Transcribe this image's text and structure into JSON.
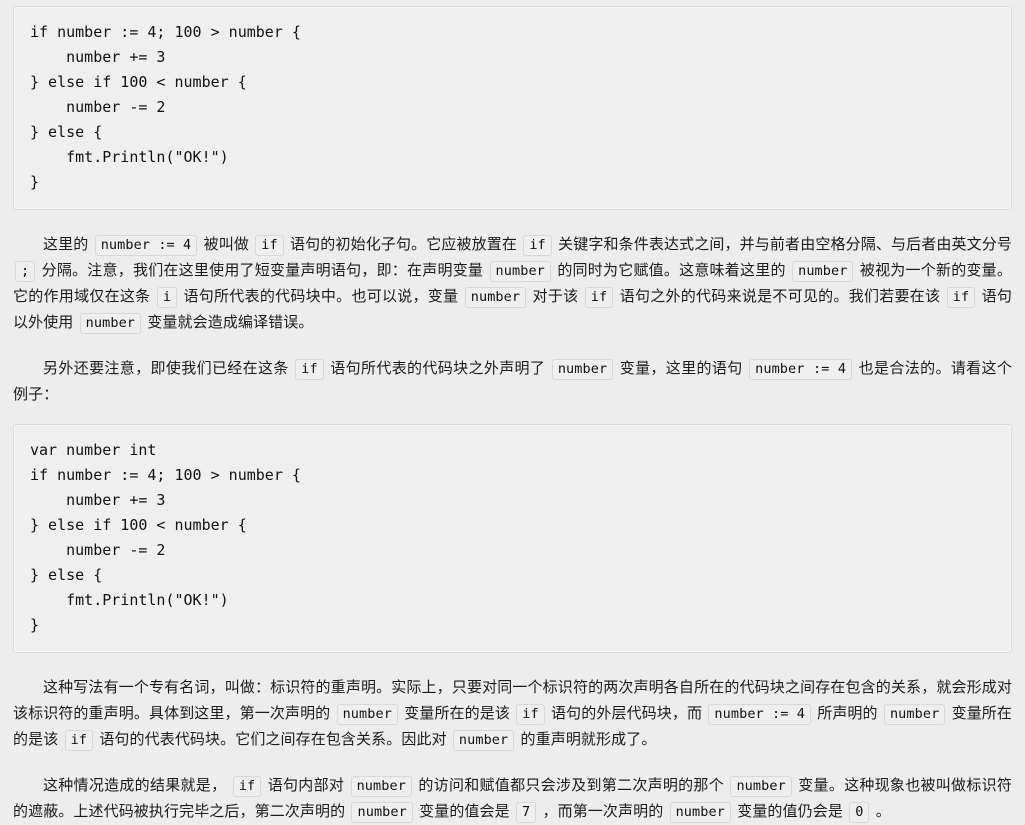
{
  "code_blocks": [
    {
      "id": "code-block-1",
      "language": "go",
      "lines": [
        "if number := 4; 100 > number {",
        "    number += 3",
        "} else if 100 < number {",
        "    number -= 2",
        "} else {",
        "    fmt.Println(\"OK!\")",
        "}"
      ],
      "text": "if number := 4; 100 > number {\n    number += 3\n} else if 100 < number {\n    number -= 2\n} else {\n    fmt.Println(\"OK!\")\n}"
    },
    {
      "id": "code-block-2",
      "language": "go",
      "lines": [
        "var number int",
        "if number := 4; 100 > number {",
        "    number += 3",
        "} else if 100 < number {",
        "    number -= 2",
        "} else {",
        "    fmt.Println(\"OK!\")",
        "}"
      ],
      "text": "var number int\nif number := 4; 100 > number {\n    number += 3\n} else if 100 < number {\n    number -= 2\n} else {\n    fmt.Println(\"OK!\")\n}"
    }
  ],
  "paragraphs": [
    {
      "id": "paragraph-1",
      "segments": [
        {
          "type": "text",
          "value": "这里的 "
        },
        {
          "type": "code",
          "value": "number := 4"
        },
        {
          "type": "text",
          "value": " 被叫做 "
        },
        {
          "type": "code",
          "value": "if"
        },
        {
          "type": "text",
          "value": " 语句的初始化子句。它应被放置在 "
        },
        {
          "type": "code",
          "value": "if"
        },
        {
          "type": "text",
          "value": " 关键字和条件表达式之间，并与前者由空格分隔、与后者由英文分号 "
        },
        {
          "type": "code",
          "value": ";"
        },
        {
          "type": "text",
          "value": " 分隔。注意，我们在这里使用了短变量声明语句，即：在声明变量 "
        },
        {
          "type": "code",
          "value": "number"
        },
        {
          "type": "text",
          "value": " 的同时为它赋值。这意味着这里的 "
        },
        {
          "type": "code",
          "value": "number"
        },
        {
          "type": "text",
          "value": " 被视为一个新的变量。它的作用域仅在这条 "
        },
        {
          "type": "code",
          "value": "i"
        },
        {
          "type": "text",
          "value": " 语句所代表的代码块中。也可以说，变量 "
        },
        {
          "type": "code",
          "value": "number"
        },
        {
          "type": "text",
          "value": " 对于该 "
        },
        {
          "type": "code",
          "value": "if"
        },
        {
          "type": "text",
          "value": " 语句之外的代码来说是不可见的。我们若要在该 "
        },
        {
          "type": "code",
          "value": "if"
        },
        {
          "type": "text",
          "value": " 语句以外使用 "
        },
        {
          "type": "code",
          "value": "number"
        },
        {
          "type": "text",
          "value": " 变量就会造成编译错误。"
        }
      ]
    },
    {
      "id": "paragraph-2",
      "segments": [
        {
          "type": "text",
          "value": "另外还要注意，即使我们已经在这条 "
        },
        {
          "type": "code",
          "value": "if"
        },
        {
          "type": "text",
          "value": " 语句所代表的代码块之外声明了 "
        },
        {
          "type": "code",
          "value": "number"
        },
        {
          "type": "text",
          "value": " 变量，这里的语句 "
        },
        {
          "type": "code",
          "value": "number := 4"
        },
        {
          "type": "text",
          "value": " 也是合法的。请看这个例子："
        }
      ]
    },
    {
      "id": "paragraph-3",
      "segments": [
        {
          "type": "text",
          "value": "这种写法有一个专有名词，叫做：标识符的重声明。实际上，只要对同一个标识符的两次声明各自所在的代码块之间存在包含的关系，就会形成对该标识符的重声明。具体到这里，第一次声明的 "
        },
        {
          "type": "code",
          "value": "number"
        },
        {
          "type": "text",
          "value": " 变量所在的是该 "
        },
        {
          "type": "code",
          "value": "if"
        },
        {
          "type": "text",
          "value": " 语句的外层代码块，而 "
        },
        {
          "type": "code",
          "value": "number := 4"
        },
        {
          "type": "text",
          "value": " 所声明的 "
        },
        {
          "type": "code",
          "value": "number"
        },
        {
          "type": "text",
          "value": " 变量所在的是该 "
        },
        {
          "type": "code",
          "value": "if"
        },
        {
          "type": "text",
          "value": " 语句的代表代码块。它们之间存在包含关系。因此对 "
        },
        {
          "type": "code",
          "value": "number"
        },
        {
          "type": "text",
          "value": " 的重声明就形成了。"
        }
      ]
    },
    {
      "id": "paragraph-4",
      "segments": [
        {
          "type": "text",
          "value": "这种情况造成的结果就是， "
        },
        {
          "type": "code",
          "value": "if"
        },
        {
          "type": "text",
          "value": " 语句内部对 "
        },
        {
          "type": "code",
          "value": "number"
        },
        {
          "type": "text",
          "value": " 的访问和赋值都只会涉及到第二次声明的那个 "
        },
        {
          "type": "code",
          "value": "number"
        },
        {
          "type": "text",
          "value": " 变量。这种现象也被叫做标识符的遮蔽。上述代码被执行完毕之后，第二次声明的 "
        },
        {
          "type": "code",
          "value": "number"
        },
        {
          "type": "text",
          "value": " 变量的值会是 "
        },
        {
          "type": "code",
          "value": "7"
        },
        {
          "type": "text",
          "value": " ，而第一次声明的 "
        },
        {
          "type": "code",
          "value": "number"
        },
        {
          "type": "text",
          "value": " 变量的值仍会是 "
        },
        {
          "type": "code",
          "value": "0"
        },
        {
          "type": "text",
          "value": " 。"
        }
      ]
    }
  ],
  "colors": {
    "page_background": "#ededed",
    "code_background": "#efefef",
    "code_border": "#dcdcdc",
    "text": "#1b1b1b"
  }
}
